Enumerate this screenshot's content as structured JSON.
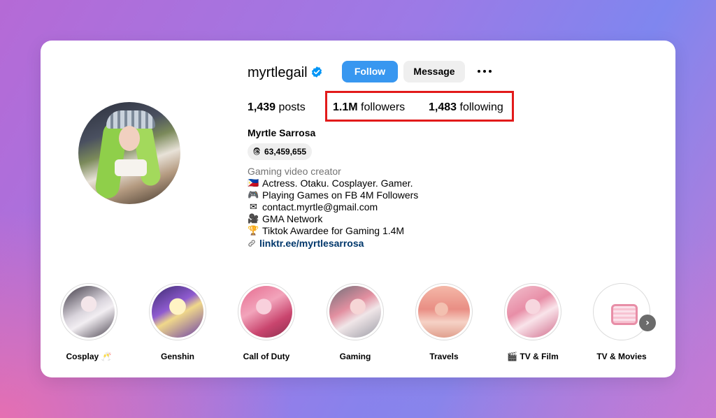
{
  "profile": {
    "username": "myrtlegail",
    "verified": true,
    "follow_label": "Follow",
    "message_label": "Message",
    "more_label": "more options",
    "stats": {
      "posts_count": "1,439",
      "posts_label": "posts",
      "followers_count": "1.1M",
      "followers_label": "followers",
      "following_count": "1,483",
      "following_label": "following"
    },
    "full_name": "Myrtle Sarrosa",
    "threads_count": "63,459,655",
    "category": "Gaming video creator",
    "bio": [
      {
        "emoji": "🇵🇭",
        "text": "Actress. Otaku. Cosplayer. Gamer."
      },
      {
        "emoji": "🎮",
        "text": "Playing Games on FB 4M Followers"
      },
      {
        "emoji": "✉",
        "text": "contact.myrtle@gmail.com"
      },
      {
        "emoji": "🎥",
        "text": "GMA Network"
      },
      {
        "emoji": "🏆",
        "text": "Tiktok Awardee for Gaming 1.4M"
      }
    ],
    "link": "linktr.ee/myrtlesarrosa"
  },
  "highlights": [
    {
      "label": "Cosplay 🥂"
    },
    {
      "label": "Genshin"
    },
    {
      "label": "Call of Duty"
    },
    {
      "label": "Gaming"
    },
    {
      "label": "Travels"
    },
    {
      "label": "🎬 TV & Film"
    },
    {
      "label": "TV & Movies"
    }
  ],
  "colors": {
    "follow_button": "#3897f0",
    "highlight_box": "#e21a1a",
    "link": "#00376b",
    "verified_badge": "#0095f6"
  },
  "icons": {
    "verified": "verified-badge-icon",
    "threads": "threads-icon",
    "link": "link-icon",
    "more": "more-dots-icon",
    "next": "chevron-right-icon"
  }
}
